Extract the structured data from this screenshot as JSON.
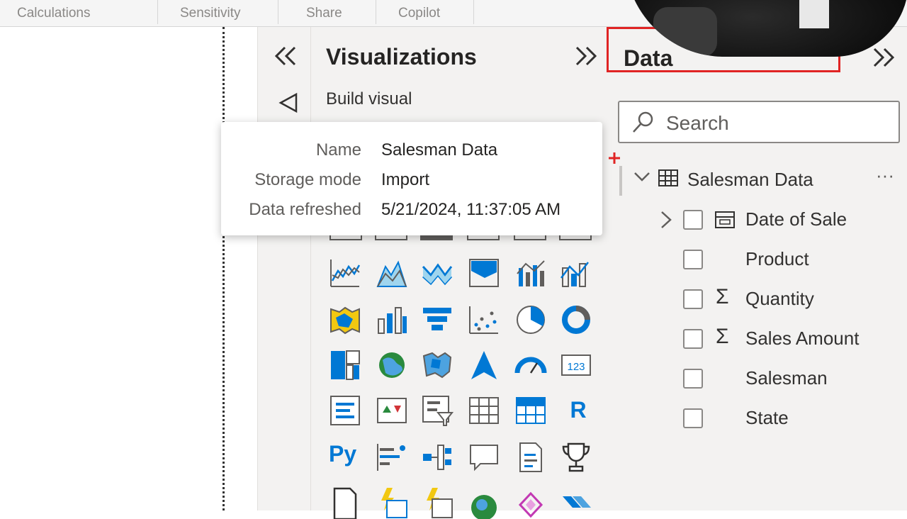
{
  "ribbon": {
    "items": [
      "Calculations",
      "Sensitivity",
      "Share",
      "Copilot"
    ]
  },
  "visualizations": {
    "title": "Visualizations",
    "build_visual": "Build visual",
    "collapse_icon": "double-chevron-left-icon",
    "expand_icon": "double-chevron-right-icon"
  },
  "tooltip": {
    "name_label": "Name",
    "name_value": "Salesman Data",
    "storage_label": "Storage mode",
    "storage_value": "Import",
    "refreshed_label": "Data refreshed",
    "refreshed_value": "5/21/2024, 11:37:05 AM"
  },
  "data_pane": {
    "title": "Data",
    "search_placeholder": "Search",
    "table_name": "Salesman Data",
    "more_label": "···",
    "fields": [
      {
        "name": "Date of Sale",
        "icon": "calendar-icon"
      },
      {
        "name": "Product",
        "icon": ""
      },
      {
        "name": "Quantity",
        "icon": "sigma-icon"
      },
      {
        "name": "Sales Amount",
        "icon": "sigma-icon"
      },
      {
        "name": "Salesman",
        "icon": ""
      },
      {
        "name": "State",
        "icon": ""
      }
    ]
  },
  "viz_icons": {
    "r_label": "R",
    "py_label": "Py",
    "card_label": "123"
  },
  "colors": {
    "accent": "#0078d4",
    "highlight_border": "#e02424",
    "pane_bg": "#f3f2f1"
  }
}
